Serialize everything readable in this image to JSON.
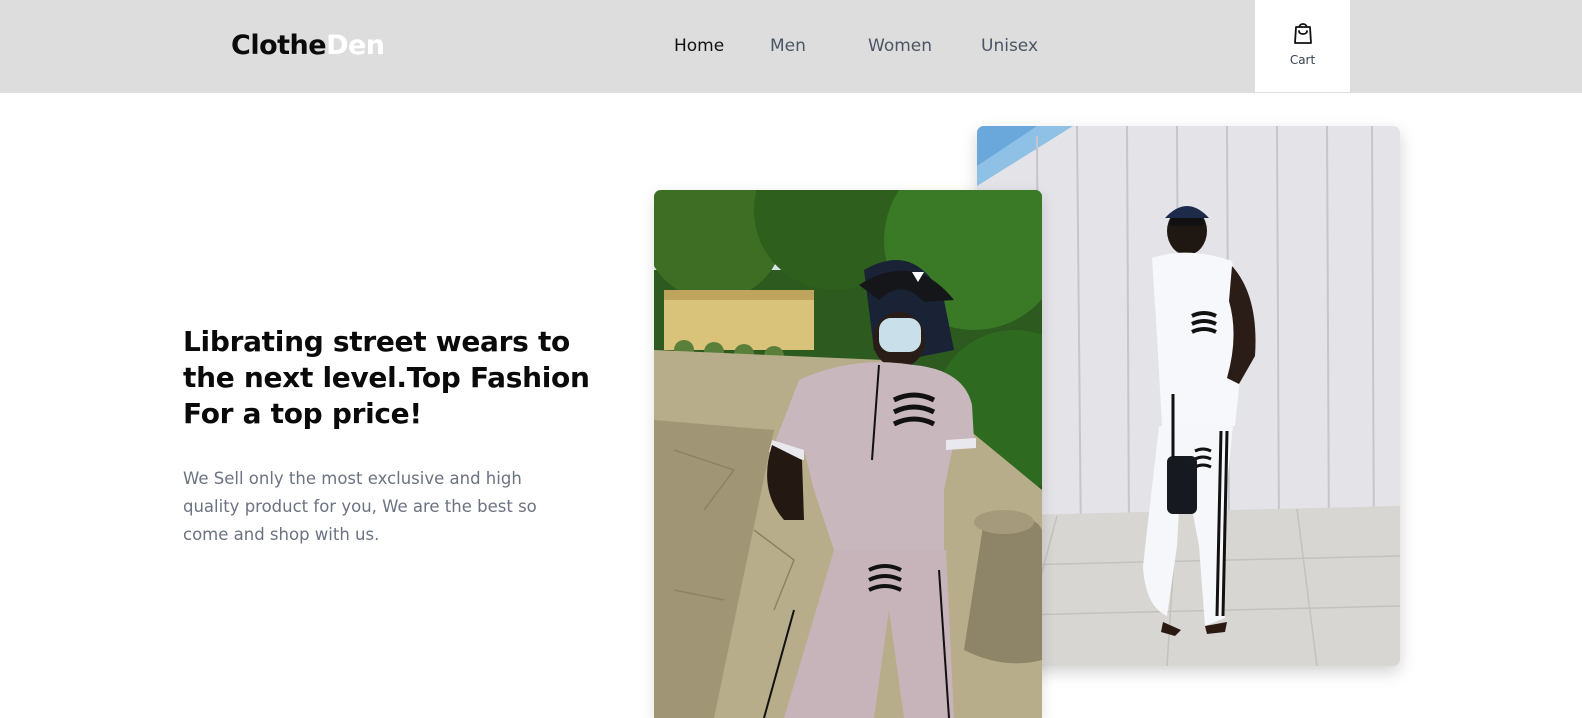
{
  "header": {
    "logo": {
      "part1": "Clothe",
      "part2": "Den"
    },
    "nav": [
      {
        "label": "Home",
        "active": true
      },
      {
        "label": "Men",
        "active": false
      },
      {
        "label": "Women",
        "active": false
      },
      {
        "label": "Unisex",
        "active": false
      }
    ],
    "cart": {
      "label": "Cart",
      "icon": "shopping-bag-icon"
    }
  },
  "hero": {
    "title": "Librating street wears to the next level.Top Fashion For a top price!",
    "description": "We Sell only the most exclusive and high quality product for you, We are the best so come and shop with us."
  },
  "colors": {
    "header_bg": "#dddddd",
    "text_dark": "#0a0a0a",
    "text_muted": "#6b7280",
    "logo_accent": "#ffffff"
  }
}
